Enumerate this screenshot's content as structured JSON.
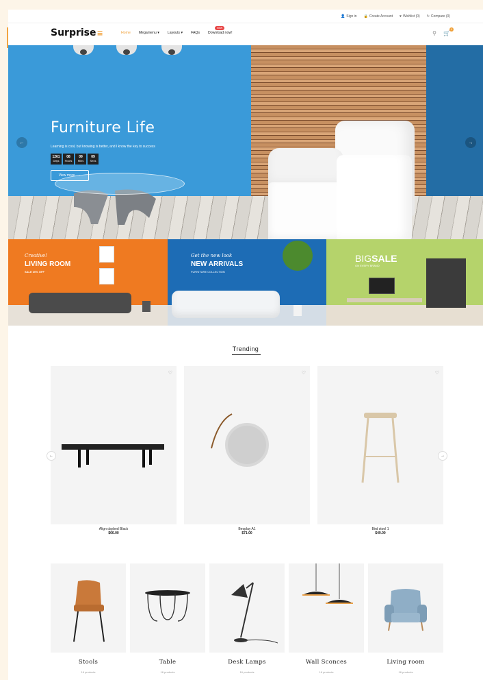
{
  "topbar": {
    "sign_in": "Sign in",
    "create_account": "Create Account",
    "wishlist": "Wishlist (0)",
    "compare": "Compare (0)"
  },
  "nav": {
    "logo": "Surprise",
    "menu": [
      "Home",
      "Megamenu ▾",
      "Layouts ▾",
      "FAQs",
      "Download now!"
    ],
    "new_badge": "NEW",
    "cart_count": "0"
  },
  "hero": {
    "title": "Furniture Life",
    "subtitle": "Learning is cool, but knowing is better, and I know the key to success",
    "countdown": [
      {
        "num": "1261",
        "unit": "Days"
      },
      {
        "num": "08",
        "unit": "Hours"
      },
      {
        "num": "09",
        "unit": "Mins"
      },
      {
        "num": "09",
        "unit": "Secs"
      }
    ],
    "cta": "View more",
    "cta_arrow": "→",
    "prev_arrow": "←",
    "next_arrow": "→"
  },
  "banners": [
    {
      "script": "Creative!",
      "title": "LIVING ROOM",
      "small": "SALE 30% OFF"
    },
    {
      "script": "Get the new look",
      "title": "NEW ARRIVALS",
      "small": "FURNITURE COLLECTION"
    },
    {
      "title_thin": "BIG",
      "title_bold": "SALE",
      "small": "ON EVERY BRAND"
    }
  ],
  "trending": {
    "title": "Trending",
    "prev_arrow": "←",
    "next_arrow": "→",
    "heart_glyph": "♡",
    "products": [
      {
        "name": "Align daybed Black",
        "price": "$66.00"
      },
      {
        "name": "Beoplay A1",
        "price": "$71.00"
      },
      {
        "name": "Bird stool 1",
        "price": "$49.00"
      }
    ]
  },
  "categories": [
    {
      "name": "Stools",
      "count": "16 products"
    },
    {
      "name": "Table",
      "count": "16 products"
    },
    {
      "name": "Desk Lamps",
      "count": "16 products"
    },
    {
      "name": "Wall Sconces",
      "count": "16 products"
    },
    {
      "name": "Living room",
      "count": "16 products"
    }
  ],
  "colors": {
    "accent": "#f0a13a",
    "hero_blue": "#3a9ad9",
    "banner_orange": "#ef7a21",
    "banner_blue": "#1d6cb5",
    "banner_green": "#b5d36b"
  }
}
